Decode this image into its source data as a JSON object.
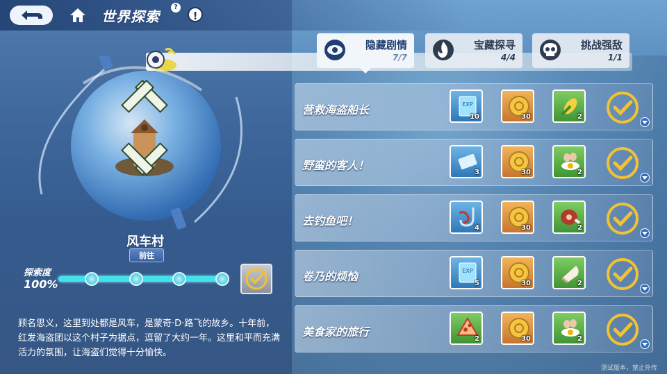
{
  "header": {
    "title": "世界探索",
    "help_glyph": "?",
    "alert_glyph": "!"
  },
  "tabs": [
    {
      "label": "隐藏剧情",
      "count": "7/7",
      "icon": "eye-icon",
      "active": true
    },
    {
      "label": "宝藏探寻",
      "count": "4/4",
      "icon": "flame-icon",
      "active": false
    },
    {
      "label": "挑战强敌",
      "count": "1/1",
      "icon": "skull-icon",
      "active": false
    }
  ],
  "quests": [
    {
      "name": "营救海盗船长",
      "rewards": [
        {
          "icon": "exp-book-icon",
          "color": "blue",
          "qty": "10"
        },
        {
          "icon": "gold-coin-icon",
          "color": "gold",
          "qty": "30"
        },
        {
          "icon": "corn-icon",
          "color": "green",
          "qty": "2"
        }
      ],
      "completed": true
    },
    {
      "name": "野蛮的客人！",
      "rewards": [
        {
          "icon": "ticket-icon",
          "color": "blue",
          "qty": "3"
        },
        {
          "icon": "gold-coin-icon",
          "color": "gold",
          "qty": "30"
        },
        {
          "icon": "egg-icon",
          "color": "green",
          "qty": "2"
        }
      ],
      "completed": true
    },
    {
      "name": "去钓鱼吧！",
      "rewards": [
        {
          "icon": "fishing-hook-icon",
          "color": "blue",
          "qty": "4"
        },
        {
          "icon": "gold-coin-icon",
          "color": "gold",
          "qty": "30"
        },
        {
          "icon": "meat-icon",
          "color": "green",
          "qty": "2"
        }
      ],
      "completed": true
    },
    {
      "name": "卷乃的烦恼",
      "rewards": [
        {
          "icon": "exp-book-icon",
          "color": "blue",
          "qty": "5"
        },
        {
          "icon": "gold-coin-icon",
          "color": "gold",
          "qty": "30"
        },
        {
          "icon": "flour-icon",
          "color": "green",
          "qty": "2"
        }
      ],
      "completed": true
    },
    {
      "name": "美食家的旅行",
      "rewards": [
        {
          "icon": "pizza-icon",
          "color": "green",
          "qty": "2"
        },
        {
          "icon": "gold-coin-icon",
          "color": "gold",
          "qty": "30"
        },
        {
          "icon": "egg-icon",
          "color": "green",
          "qty": "2"
        }
      ],
      "completed": true
    }
  ],
  "village": {
    "name": "风车村",
    "goto_label": "前往",
    "explore_label": "探索度",
    "explore_value": "100%",
    "explore_progress": 1.0,
    "nodes_completed": 4,
    "description": "顾名思义，这里到处都是风车，是蒙奇·D·路飞的故乡。十年前，红发海盗团以这个村子为据点，逗留了大约一年。这里和平而充满活力的氛围，让海盗们觉得十分愉快。"
  },
  "watermark": "测试版本，禁止外传",
  "colors": {
    "accent_cyan": "#44e0ee",
    "check_gold": "#f1c232",
    "active_tab": "#f2f6fb"
  }
}
